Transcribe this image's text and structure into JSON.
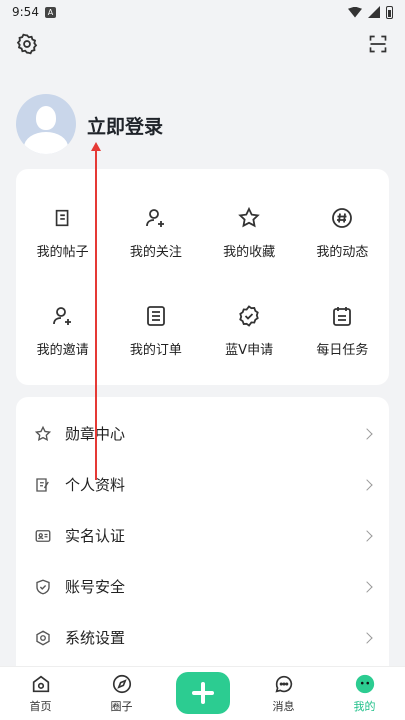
{
  "status_bar": {
    "time": "9:54",
    "notif": "A"
  },
  "profile": {
    "login_text": "立即登录"
  },
  "grid": [
    {
      "label": "我的帖子",
      "icon": "post-icon"
    },
    {
      "label": "我的关注",
      "icon": "follow-icon"
    },
    {
      "label": "我的收藏",
      "icon": "star-icon"
    },
    {
      "label": "我的动态",
      "icon": "hashtag-icon"
    },
    {
      "label": "我的邀请",
      "icon": "invite-icon"
    },
    {
      "label": "我的订单",
      "icon": "order-icon"
    },
    {
      "label": "蓝V申请",
      "icon": "verified-badge-icon"
    },
    {
      "label": "每日任务",
      "icon": "calendar-icon"
    }
  ],
  "list": [
    {
      "label": "勋章中心",
      "icon": "star-outline-icon"
    },
    {
      "label": "个人资料",
      "icon": "edit-profile-icon"
    },
    {
      "label": "实名认证",
      "icon": "id-card-icon"
    },
    {
      "label": "账号安全",
      "icon": "shield-icon"
    },
    {
      "label": "系统设置",
      "icon": "hexagon-settings-icon"
    }
  ],
  "nav": [
    {
      "label": "首页",
      "icon": "home-icon"
    },
    {
      "label": "圈子",
      "icon": "compass-icon"
    },
    {
      "label": "",
      "icon": "plus-icon"
    },
    {
      "label": "消息",
      "icon": "message-icon"
    },
    {
      "label": "我的",
      "icon": "profile-face-icon"
    }
  ],
  "colors": {
    "accent": "#2ccc91",
    "active_text": "#20c08a",
    "annotation": "#e53935"
  }
}
